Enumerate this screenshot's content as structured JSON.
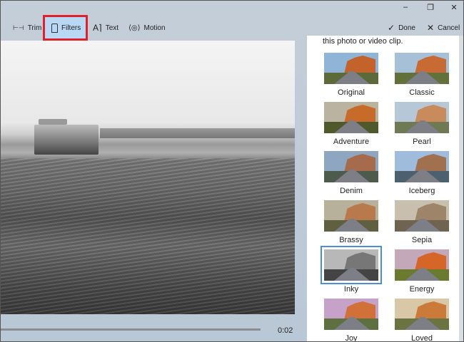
{
  "window": {
    "minimize": "–",
    "maximize": "❐",
    "close": "✕"
  },
  "toolbar": {
    "tools": [
      {
        "label": "Trim",
        "icon": "trim-icon",
        "glyph": "⊢⊣"
      },
      {
        "label": "Filters",
        "icon": "filters-icon",
        "glyph": "🖌"
      },
      {
        "label": "Text",
        "icon": "text-icon",
        "glyph": "A⌉"
      },
      {
        "label": "Motion",
        "icon": "motion-icon",
        "glyph": "⟨◎⟩"
      }
    ],
    "selected": "Filters",
    "done": "Done",
    "done_glyph": "✓",
    "cancel": "Cancel",
    "cancel_glyph": "✕"
  },
  "player": {
    "time": "0:02"
  },
  "filters_panel": {
    "description": "this photo or video clip.",
    "selected": "Inky",
    "filters": [
      {
        "label": "Original",
        "sky": "#8fb4d6",
        "rock": "#c4622c",
        "grass": "#5b6a38"
      },
      {
        "label": "Classic",
        "sky": "#a6c0d8",
        "rock": "#c86a34",
        "grass": "#62703c"
      },
      {
        "label": "Adventure",
        "sky": "#b9b3a0",
        "rock": "#c76b2a",
        "grass": "#4f5a2c"
      },
      {
        "label": "Pearl",
        "sky": "#b6c8d8",
        "rock": "#c98a5c",
        "grass": "#6f7a55"
      },
      {
        "label": "Denim",
        "sky": "#8ea6c0",
        "rock": "#a66a4c",
        "grass": "#4c5b4c"
      },
      {
        "label": "Iceberg",
        "sky": "#9fbcdc",
        "rock": "#a0704f",
        "grass": "#4d6070"
      },
      {
        "label": "Brassy",
        "sky": "#b7b09a",
        "rock": "#b87a4c",
        "grass": "#5f6040"
      },
      {
        "label": "Sepia",
        "sky": "#c8bfae",
        "rock": "#9e8468",
        "grass": "#6e6450"
      },
      {
        "label": "Inky",
        "sky": "#b8b8b8",
        "rock": "#777777",
        "grass": "#444444"
      },
      {
        "label": "Energy",
        "sky": "#c2a8b8",
        "rock": "#d66628",
        "grass": "#6a7a2e"
      },
      {
        "label": "Joy",
        "sky": "#c6a2c8",
        "rock": "#d2703a",
        "grass": "#5f7040"
      },
      {
        "label": "Loved",
        "sky": "#d8c8a8",
        "rock": "#cc7a3a",
        "grass": "#6b7440"
      }
    ]
  },
  "colors": {
    "highlight_border": "#e0202a",
    "selected_tool_bg": "#b8d8f4",
    "selection_outline": "#4a8fd8"
  }
}
